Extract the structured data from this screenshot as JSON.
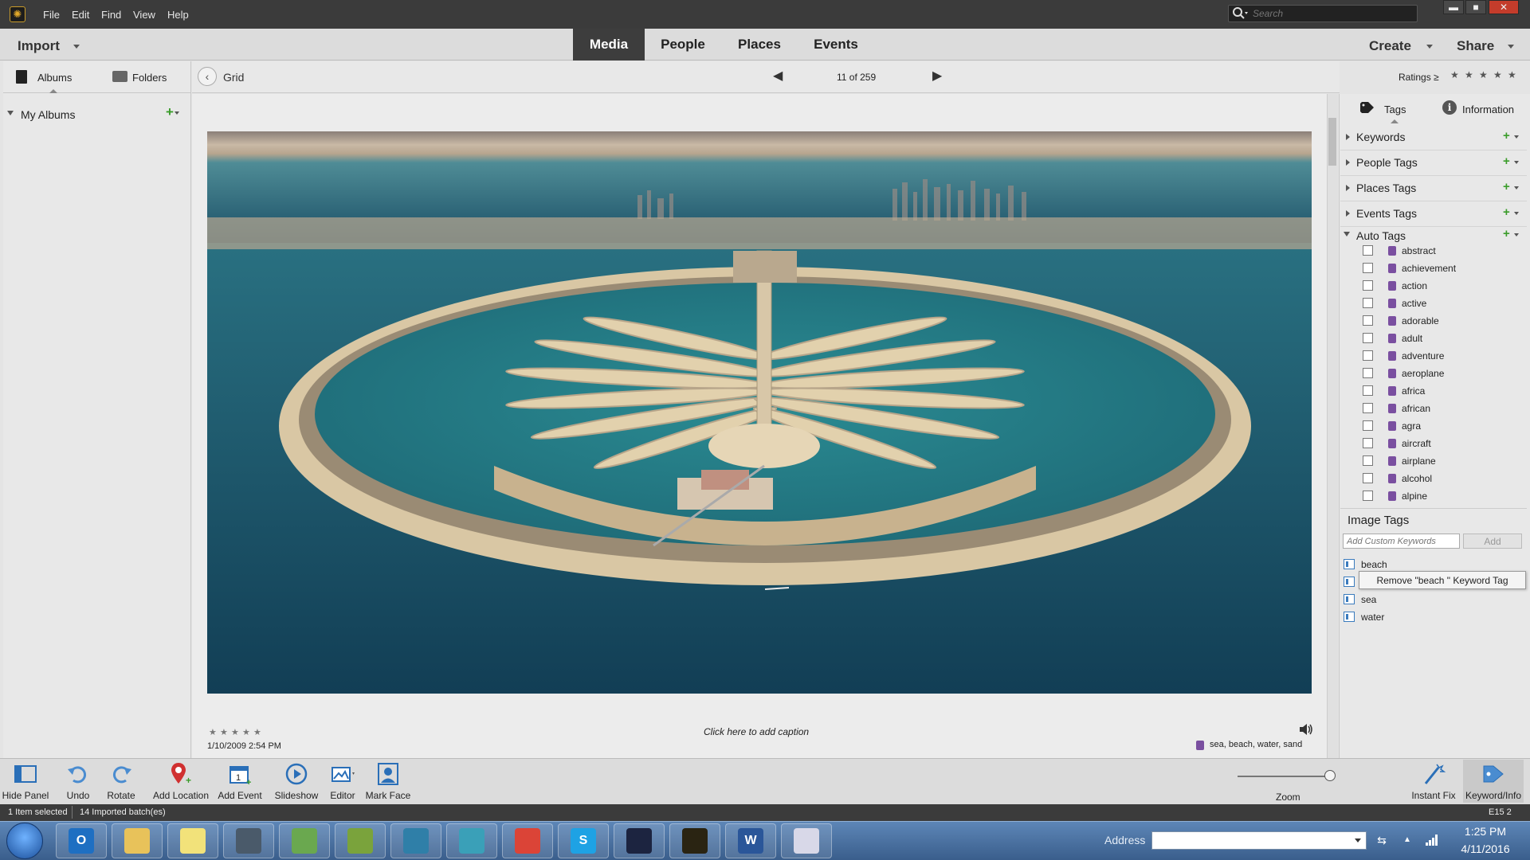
{
  "menu": {
    "items": [
      "File",
      "Edit",
      "Find",
      "View",
      "Help"
    ],
    "search_placeholder": "Search"
  },
  "window_controls": {
    "minimize": "▬",
    "maximize": "■",
    "close": "✕"
  },
  "toolbar": {
    "import_label": "Import",
    "tabs": [
      {
        "label": "Media",
        "active": true
      },
      {
        "label": "People",
        "active": false
      },
      {
        "label": "Places",
        "active": false
      },
      {
        "label": "Events",
        "active": false
      }
    ],
    "create_label": "Create",
    "share_label": "Share"
  },
  "left_panel": {
    "tabs": [
      {
        "label": "Albums",
        "active": true,
        "icon": "albums-icon"
      },
      {
        "label": "Folders",
        "active": false,
        "icon": "folder-icon"
      }
    ],
    "my_albums_label": "My Albums",
    "add_symbol": "+"
  },
  "viewer_header": {
    "back_symbol": "‹",
    "grid_label": "Grid",
    "prev_symbol": "◀",
    "next_symbol": "▶",
    "page_count": "11 of 259",
    "ratings_label": "Ratings ≥",
    "rating_star": "★"
  },
  "photo": {
    "description_icon": "aerial-photo",
    "date": "1/10/2009 2:54 PM",
    "star": "★",
    "star_count": 5,
    "caption_placeholder": "Click here to add caption",
    "tags_summary": "sea, beach, water, sand"
  },
  "right_panel": {
    "tabs": [
      {
        "label": "Tags",
        "active": true,
        "icon": "tag-icon"
      },
      {
        "label": "Information",
        "active": false,
        "icon": "info-icon"
      }
    ],
    "info_glyph": "i",
    "sections": [
      {
        "label": "Keywords",
        "open": false
      },
      {
        "label": "People Tags",
        "open": false
      },
      {
        "label": "Places Tags",
        "open": false
      },
      {
        "label": "Events Tags",
        "open": false
      },
      {
        "label": "Auto Tags",
        "open": true
      }
    ],
    "add_symbol": "+",
    "auto_tags": [
      "abstract",
      "achievement",
      "action",
      "active",
      "adorable",
      "adult",
      "adventure",
      "aeroplane",
      "africa",
      "african",
      "agra",
      "aircraft",
      "airplane",
      "alcohol",
      "alpine"
    ],
    "image_tags_label": "Image Tags",
    "custom_keywords_placeholder": "Add Custom Keywords",
    "add_button_label": "Add",
    "image_tags": [
      "beach",
      "",
      "sea",
      "water"
    ],
    "tooltip": "Remove \"beach \" Keyword Tag"
  },
  "bottom_toolbar": {
    "tools": [
      {
        "label": "Hide Panel",
        "icon": "hide-panel-icon"
      },
      {
        "label": "Undo",
        "icon": "undo-icon"
      },
      {
        "label": "Rotate",
        "icon": "rotate-icon"
      },
      {
        "label": "Add Location",
        "icon": "location-pin-icon"
      },
      {
        "label": "Add Event",
        "icon": "calendar-icon"
      },
      {
        "label": "Slideshow",
        "icon": "play-icon"
      },
      {
        "label": "Editor",
        "icon": "editor-icon"
      },
      {
        "label": "Mark Face",
        "icon": "face-icon"
      }
    ],
    "zoom_label": "Zoom",
    "zoom_level": 0.95,
    "right_tools": [
      {
        "label": "Instant Fix",
        "icon": "wand-icon"
      },
      {
        "label": "Keyword/Info",
        "icon": "keyword-tag-icon"
      }
    ]
  },
  "statusbar": {
    "selected": "1 Item selected",
    "batches": "14 Imported batch(es)",
    "version": "E15 2"
  },
  "taskbar": {
    "apps": [
      {
        "name": "outlook",
        "glyph": "O",
        "color": "#1e6fc2"
      },
      {
        "name": "file-explorer",
        "glyph": "",
        "color": "#e8c25a"
      },
      {
        "name": "sticky-notes",
        "glyph": "",
        "color": "#f2e27a"
      },
      {
        "name": "screen-keyboard",
        "glyph": "",
        "color": "#4a5a6a"
      },
      {
        "name": "sound-recorder",
        "glyph": "",
        "color": "#6aa84f"
      },
      {
        "name": "android-studio",
        "glyph": "",
        "color": "#7aa33c"
      },
      {
        "name": "network-globe",
        "glyph": "",
        "color": "#2f7fa8"
      },
      {
        "name": "grid-app",
        "glyph": "",
        "color": "#3aa0b8"
      },
      {
        "name": "chrome",
        "glyph": "",
        "color": "#db4437"
      },
      {
        "name": "skype",
        "glyph": "S",
        "color": "#1ea2e4"
      },
      {
        "name": "premiere-elements",
        "glyph": "",
        "color": "#1c2440"
      },
      {
        "name": "photoshop-elements",
        "glyph": "",
        "color": "#2a2412"
      },
      {
        "name": "word",
        "glyph": "W",
        "color": "#2a5699"
      },
      {
        "name": "paint",
        "glyph": "",
        "color": "#d8d8e8"
      }
    ],
    "address_label": "Address",
    "clock_time": "1:25 PM",
    "clock_date": "4/11/2016"
  }
}
